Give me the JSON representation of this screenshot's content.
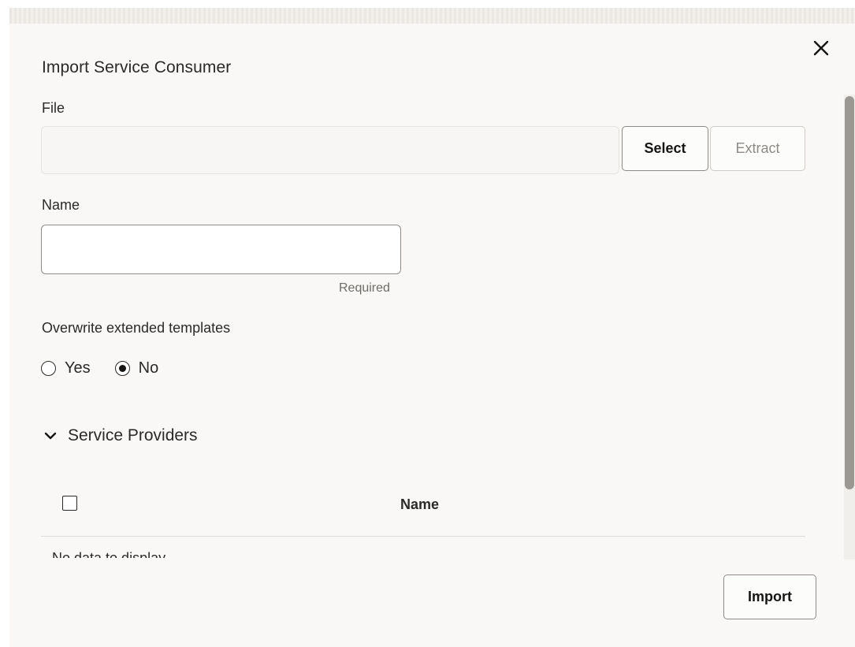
{
  "dialog": {
    "title": "Import Service Consumer",
    "close_icon": "close-icon"
  },
  "file": {
    "label": "File",
    "value": "",
    "select_label": "Select",
    "extract_label": "Extract"
  },
  "name_field": {
    "label": "Name",
    "value": "",
    "placeholder": "",
    "helper": "Required"
  },
  "overwrite": {
    "label": "Overwrite extended templates",
    "options": [
      {
        "label": "Yes",
        "selected": false
      },
      {
        "label": "No",
        "selected": true
      }
    ]
  },
  "providers": {
    "section_label": "Service Providers",
    "expanded": true,
    "toggle_icon": "chevron-down-icon",
    "table": {
      "columns": [
        "Name"
      ],
      "partial_row_text": "No data to display."
    }
  },
  "footer": {
    "import_label": "Import"
  }
}
